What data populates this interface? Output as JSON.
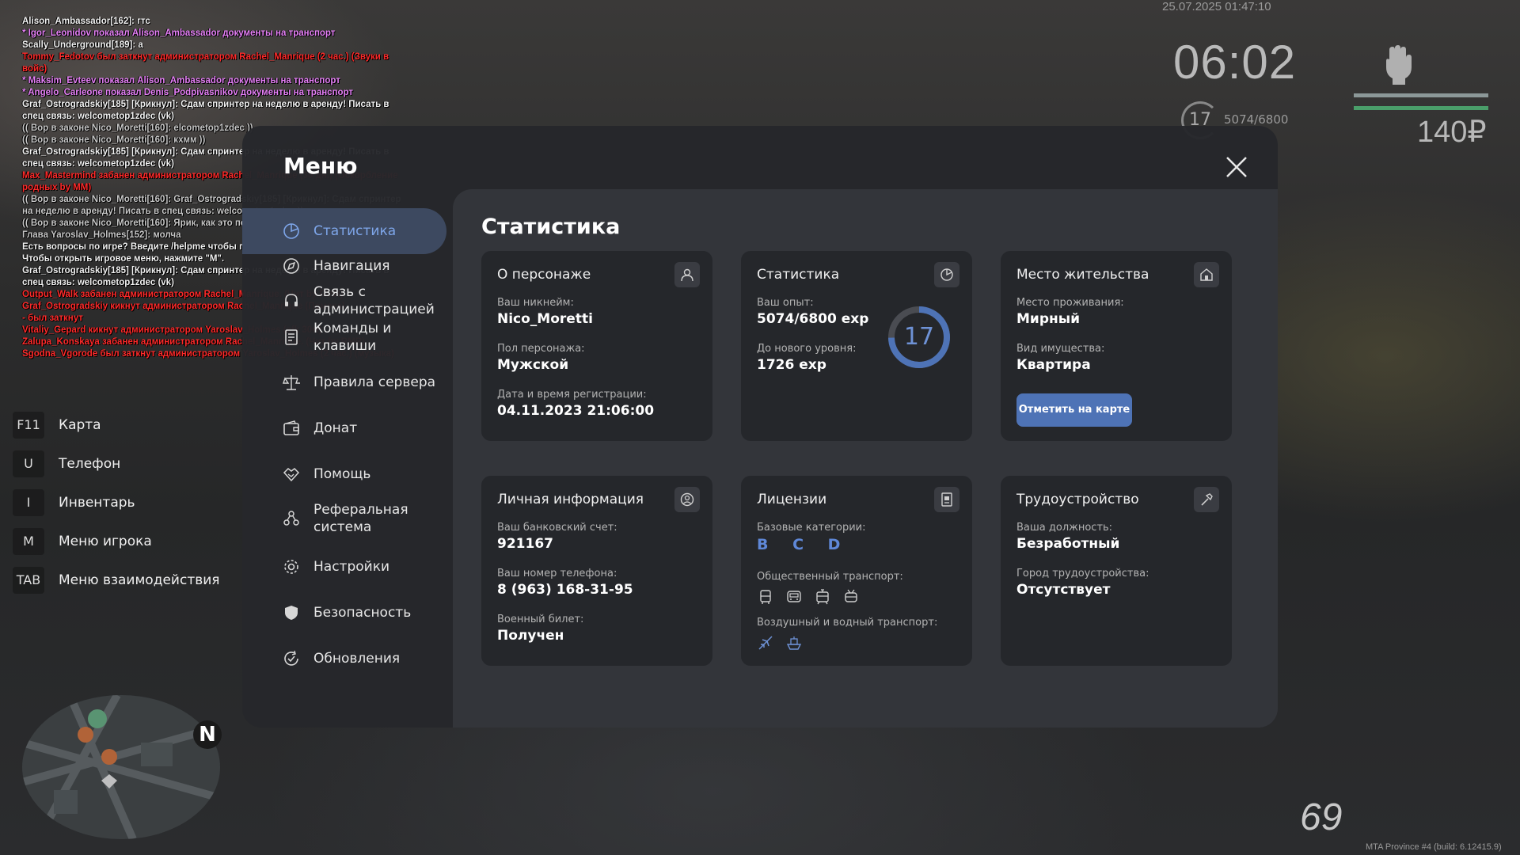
{
  "chat": [
    {
      "text": "Alison_Ambassador[162]: гтс",
      "color": "white"
    },
    {
      "text": "* Igor_Leonidov показал Alison_Ambassador документы на транспорт",
      "color": "pink"
    },
    {
      "text": "Scally_Underground[189]: а",
      "color": "white"
    },
    {
      "text": "Tommy_Fedotov был заткнут администратором Rachel_Manrique (2 час.) (Звуки в войс)",
      "color": "red"
    },
    {
      "text": "* Maksim_Evteev показал Alison_Ambassador документы на транспорт",
      "color": "pink"
    },
    {
      "text": "* Angelo_Carleone показал Denis_Podpivasnikov документы на транспорт",
      "color": "pink"
    },
    {
      "text": "Graf_Ostrogradskiy[185] [Крикнул]: Сдам спринтер на неделю в аренду! Писать в спец связь: welcometop1zdec (vk)",
      "color": "white"
    },
    {
      "text": "(( Вор в законе Nico_Moretti[160]: elcometop1zdec ))",
      "color": "gray"
    },
    {
      "text": "(( Вор в законе Nico_Moretti[160]: кхмм ))",
      "color": "gray"
    },
    {
      "text": "Graf_Ostrogradskiy[185] [Крикнул]: Сдам спринтер на неделю в аренду! Писать в спец связь: welcometop1zdec (vk)",
      "color": "white"
    },
    {
      "text": "Max_Mastermind забанен администратором Rachel_Manrique (30 дн.) (Оскорбление родных by MM)",
      "color": "red"
    },
    {
      "text": "(( Вор в законе Nico_Moretti[160]: Graf_Ostrogradskiy[185] [Крикнул]: Сдам спринтер на неделю в аренду! Писать в спец связь: welcometop1zdec ))",
      "color": "gray"
    },
    {
      "text": "(( Вор в законе Nico_Moretti[160]: Ярик, как это понимать? ))",
      "color": "gray"
    },
    {
      "text": "Глава Yaroslav_Holmes[152]: молча",
      "color": "gray"
    },
    {
      "text": "Есть вопросы по игре? Введите /helpme чтобы получить нужную информацию.",
      "color": "white"
    },
    {
      "text": "Чтобы открыть игровое меню, нажмите \"M\".",
      "color": "white"
    },
    {
      "text": "Graf_Ostrogradskiy[185] [Крикнул]: Сдам спринтер на неделю в аренду! Писать в спец связь: welcometop1zdec (vk)",
      "color": "white"
    },
    {
      "text": "Output_Walk забанен администратором Rachel_Manrique. (Чит by RMR)",
      "color": "red"
    },
    {
      "text": "Graf_Ostrogradskiy кикнут администратором Rachel_Manrique (Помеха)",
      "color": "red"
    },
    {
      "text": "- был заткнут",
      "color": "red"
    },
    {
      "text": "Vitaliy_Gepard кикнут администратором Yaroslav_Holmes (afk 30м)",
      "color": "red"
    },
    {
      "text": "Zalupa_Konskaya забанен администратором Rachel_Manrique. (Чит by RMR)",
      "color": "red"
    },
    {
      "text": "Sgodna_Vgorode был заткнут администратором Yaroslav_Holmes (2 час.) (музыка)",
      "color": "red"
    }
  ],
  "hud": {
    "datetime": "25.07.2025 01:47:10",
    "clock": "06:02",
    "level": "17",
    "exp": "5074/6800",
    "money": "140₽",
    "speed": "69",
    "build": "MTA Province #4 (build: 6.12415.9)",
    "north": "N",
    "health_fraction": 1.0,
    "armor_fraction": 1.0
  },
  "hotkeys": [
    {
      "key": "F11",
      "label": "Карта"
    },
    {
      "key": "U",
      "label": "Телефон"
    },
    {
      "key": "I",
      "label": "Инвентарь"
    },
    {
      "key": "M",
      "label": "Меню игрока"
    },
    {
      "key": "TAB",
      "label": "Меню взаимодействия"
    }
  ],
  "menu": {
    "title": "Меню",
    "nav": [
      {
        "label": "Статистика",
        "icon": "chart-pie-icon",
        "active": true
      },
      {
        "label": "Навигация",
        "icon": "compass-icon",
        "active": false
      },
      {
        "label": "Связь с администрацией",
        "icon": "headset-icon",
        "active": false
      },
      {
        "label": "Команды и клавиши",
        "icon": "document-icon",
        "active": false
      },
      {
        "label": "Правила сервера",
        "icon": "scales-icon",
        "active": false
      },
      {
        "label": "Донат",
        "icon": "wallet-icon",
        "active": false
      },
      {
        "label": "Помощь",
        "icon": "handshake-icon",
        "active": false
      },
      {
        "label": "Реферальная система",
        "icon": "people-network-icon",
        "active": false
      },
      {
        "label": "Настройки",
        "icon": "gear-icon",
        "active": false
      },
      {
        "label": "Безопасность",
        "icon": "shield-icon",
        "active": false
      },
      {
        "label": "Обновления",
        "icon": "refresh-check-icon",
        "active": false
      }
    ],
    "content_title": "Статистика",
    "character": {
      "title": "О персонаже",
      "nickname_label": "Ваш никнейм:",
      "nickname": "Nico_Moretti",
      "gender_label": "Пол персонажа:",
      "gender": "Мужской",
      "reg_label": "Дата и время регистрации:",
      "reg": "04.11.2023 21:06:00"
    },
    "stats": {
      "title": "Статистика",
      "exp_label": "Ваш опыт:",
      "exp": "5074/6800 exp",
      "next_label": "До нового уровня:",
      "next": "1726 exp",
      "level": "17",
      "progress": 0.746
    },
    "residence": {
      "title": "Место жительства",
      "place_label": "Место проживания:",
      "place": "Мирный",
      "type_label": "Вид имущества:",
      "type": "Квартира",
      "button": "Отметить на карте"
    },
    "personal": {
      "title": "Личная информация",
      "bank_label": "Ваш банковский счет:",
      "bank": "921167",
      "phone_label": "Ваш номер телефона:",
      "phone": "8 (963) 168-31-95",
      "military_label": "Военный билет:",
      "military": "Получен"
    },
    "licenses": {
      "title": "Лицензии",
      "base_label": "Базовые категории:",
      "base": "B C D",
      "public_label": "Общественный транспорт:",
      "public_icons": [
        "bus-icon",
        "bus-front-icon",
        "tram-icon",
        "trolleybus-icon"
      ],
      "airwater_label": "Воздушный и водный транспорт:",
      "airwater_icons": [
        "plane-icon",
        "boat-icon"
      ]
    },
    "job": {
      "title": "Трудоустройство",
      "position_label": "Ваша должность:",
      "position": "Безработный",
      "city_label": "Город трудоустройства:",
      "city": "Отсутствует"
    }
  }
}
